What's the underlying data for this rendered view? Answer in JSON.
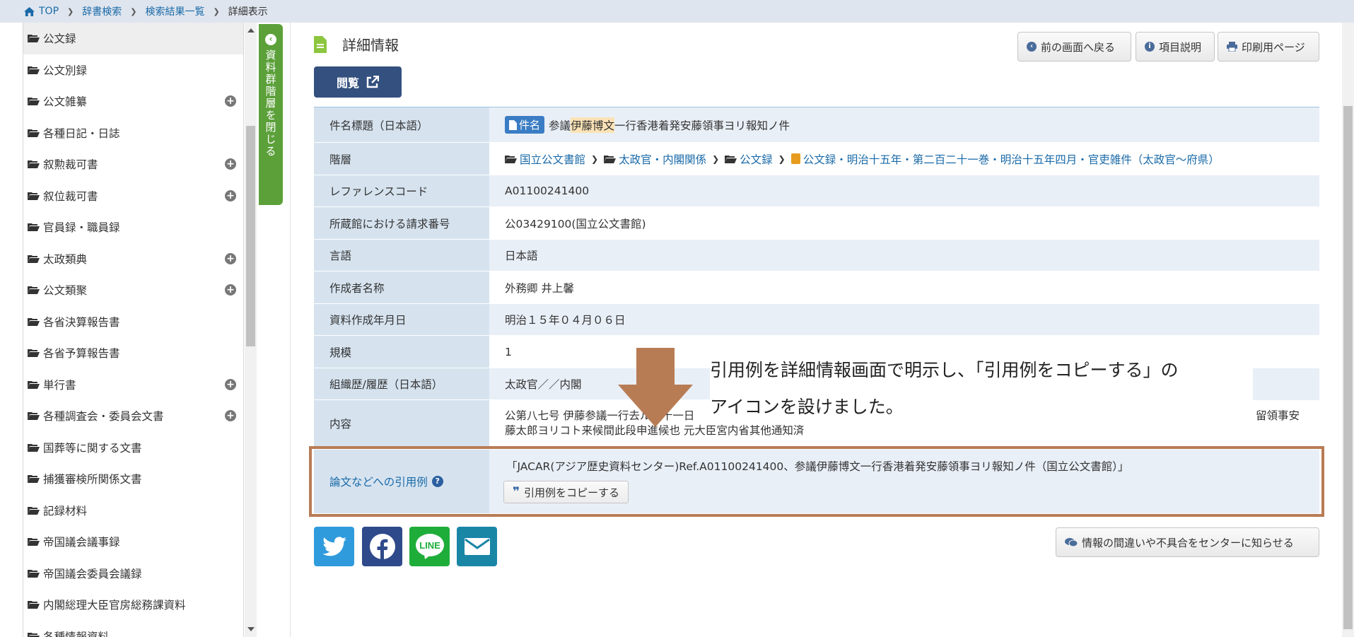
{
  "breadcrumb": {
    "items": [
      "TOP",
      "辞書検索",
      "検索結果一覧"
    ],
    "current": "詳細表示"
  },
  "sidebar": {
    "items": [
      {
        "label": "公文録",
        "expandable": false
      },
      {
        "label": "公文別録",
        "expandable": false
      },
      {
        "label": "公文雑纂",
        "expandable": true
      },
      {
        "label": "各種日記・日誌",
        "expandable": false
      },
      {
        "label": "叙勲裁可書",
        "expandable": true
      },
      {
        "label": "叙位裁可書",
        "expandable": true
      },
      {
        "label": "官員録・職員録",
        "expandable": false
      },
      {
        "label": "太政類典",
        "expandable": true
      },
      {
        "label": "公文類聚",
        "expandable": true
      },
      {
        "label": "各省決算報告書",
        "expandable": false
      },
      {
        "label": "各省予算報告書",
        "expandable": false
      },
      {
        "label": "単行書",
        "expandable": true
      },
      {
        "label": "各種調査会・委員会文書",
        "expandable": true
      },
      {
        "label": "国葬等に関する文書",
        "expandable": false
      },
      {
        "label": "捕獲審検所関係文書",
        "expandable": false
      },
      {
        "label": "記録材料",
        "expandable": false
      },
      {
        "label": "帝国議会議事録",
        "expandable": false
      },
      {
        "label": "帝国議会委員会議録",
        "expandable": false
      },
      {
        "label": "内閣総理大臣官房総務課資料",
        "expandable": false
      },
      {
        "label": "各種情報資料",
        "expandable": false
      }
    ],
    "close_tab_label": "資料群階層を閉じる"
  },
  "main": {
    "title": "詳細情報",
    "buttons": {
      "back": "前の画面へ戻る",
      "help": "項目説明",
      "print": "印刷用ページ",
      "view": "閲覧"
    },
    "rows": {
      "title_label": "件名標題（日本語）",
      "title_badge": "件名",
      "title_pre": "参議",
      "title_hl": "伊藤博文",
      "title_post": "一行香港着発安藤領事ヨリ報知ノ件",
      "hierarchy_label": "階層",
      "hierarchy": [
        "国立公文書館",
        "太政官・内閣関係",
        "公文録",
        "公文録・明治十五年・第二百二十一巻・明治十五年四月・官吏雑件（太政官～府県）"
      ],
      "refcode_label": "レファレンスコード",
      "refcode": "A01100241400",
      "callno_label": "所蔵館における請求番号",
      "callno": "公03429100(国立公文書館)",
      "lang_label": "言語",
      "lang": "日本語",
      "creator_label": "作成者名称",
      "creator": "外務卿 井上馨",
      "date_label": "資料作成年月日",
      "date": "明治１５年０４月０６日",
      "scale_label": "規模",
      "scale": "1",
      "org_label": "組織歴/履歴（日本語）",
      "org": "太政官／／内閣",
      "content_label": "内容",
      "content_line1": "公第八七号 伊藤参議一行去ル二十一日",
      "content_line1_right": "留領事安",
      "content_line2": "藤太郎ヨリコト来候間此段申進候也 元大臣宮内省其他通知済"
    },
    "citation": {
      "label": "論文などへの引用例",
      "text": "「JACAR(アジア歴史資料センター)Ref.A01100241400、参議伊藤博文一行香港着発安藤領事ヨリ報知ノ件（国立公文書館）」",
      "copy_button": "引用例をコピーする"
    },
    "report_button": "情報の間違いや不具合をセンターに知らせる"
  },
  "annotation": {
    "line1": "引用例を詳細情報画面で明示し、「引用例をコピーする」の",
    "line2": "アイコンを設けました。",
    "arrow_color": "#b87c55"
  },
  "colors": {
    "header_bar": "#dfe5ee",
    "label_bg": "#d6e3ef",
    "value_bg": "#e9eff7",
    "view_button": "#34507f",
    "green_tab": "#5ca03a",
    "twitter": "#2f9bdc",
    "facebook": "#2f4a8a",
    "line": "#1fad3a",
    "mail": "#1a86a6"
  }
}
